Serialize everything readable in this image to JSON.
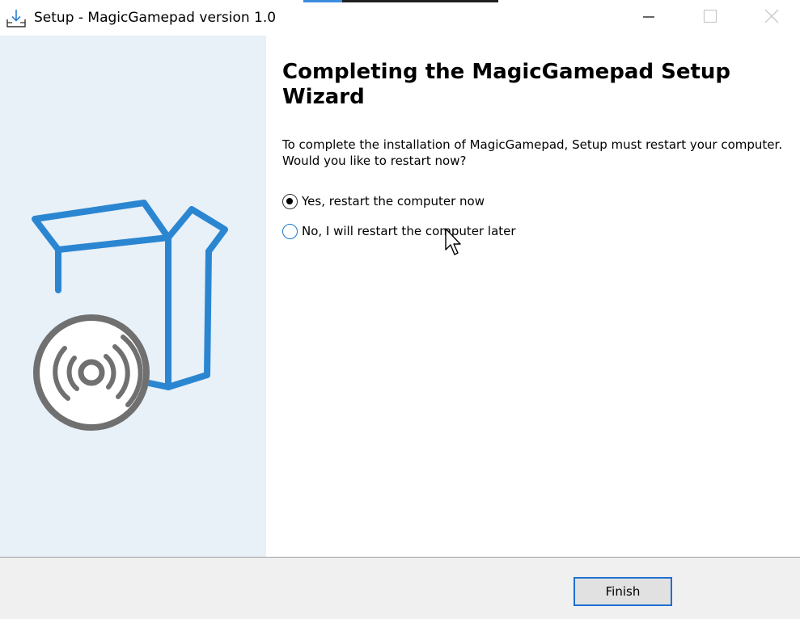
{
  "window": {
    "title": "Setup - MagicGamepad version 1.0",
    "icons": {
      "app": "setup-download-icon",
      "minimize": "minimize-icon",
      "maximize": "maximize-icon",
      "close": "close-icon"
    }
  },
  "sidebar": {
    "graphic": "software-box-with-disc-icon"
  },
  "main": {
    "heading": "Completing the MagicGamepad Setup Wizard",
    "message": "To complete the installation of MagicGamepad, Setup must restart your computer. Would you like to restart now?",
    "options": [
      {
        "label": "Yes, restart the computer now",
        "selected": true
      },
      {
        "label": "No, I will restart the computer later",
        "selected": false
      }
    ]
  },
  "footer": {
    "finish_label": "Finish"
  },
  "colors": {
    "sidebar_bg": "#e8f0f8",
    "accent_blue": "#1f6fd2",
    "graphic_blue": "#2b86d1",
    "graphic_gray": "#707070",
    "footer_bg": "#f0f0f0"
  }
}
